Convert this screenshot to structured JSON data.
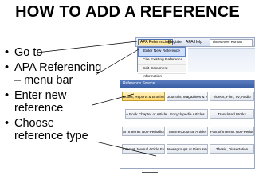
{
  "title": "HOW TO ADD A REFERENCE",
  "bullets": [
    {
      "lines": [
        "Go to"
      ]
    },
    {
      "lines": [
        "APA Referencing",
        "– menu bar"
      ]
    },
    {
      "lines": [
        "Enter new",
        "reference"
      ]
    },
    {
      "lines": [
        "Choose",
        "reference type"
      ]
    }
  ],
  "menubar": {
    "apa": "APA Referencing",
    "register": "Register",
    "help": "APA Help",
    "font": "Times New Roman"
  },
  "dropdown": [
    "Enter New Reference",
    "Cite Existing Reference",
    "Edit Document Information"
  ],
  "dialog": {
    "title": "Reference Source",
    "rows": [
      [
        "Books, Reports & Brochures",
        "Journals, Magazines & Newspapers",
        "Videos, Film, TV, Audio"
      ],
      [
        "A Book Chapter or Article in a Collection",
        "Encyclopedia Articles",
        "Translated Works"
      ],
      [
        "An Internet Non-Periodical",
        "Internet Journal Article",
        "Part of Internet Non-Periodical"
      ],
      [
        "Internet Journal Article From Database",
        "Newsgroups or Discussion Group Article",
        "Thesis, Dissertation"
      ]
    ]
  }
}
